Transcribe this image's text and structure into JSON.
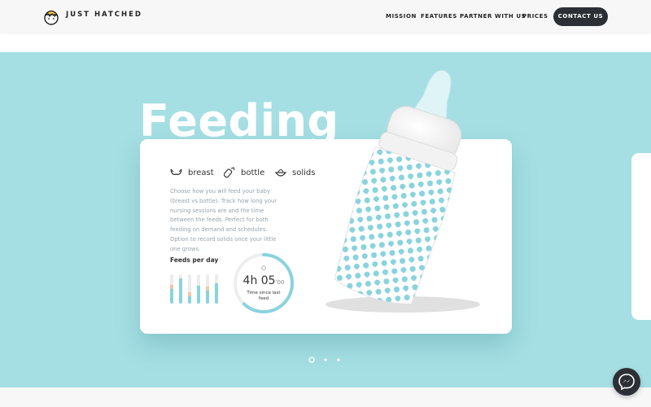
{
  "header": {
    "brand": "JUST HATCHED",
    "nav": [
      {
        "label": "MISSION"
      },
      {
        "label": "FEATURES"
      },
      {
        "label": "PARTNER WITH US"
      },
      {
        "label": "PRICES"
      }
    ],
    "contact_label": "CONTACT US"
  },
  "hero": {
    "headline": "Feeding",
    "options": [
      {
        "label": "breast",
        "icon": "bra-icon"
      },
      {
        "label": "bottle",
        "icon": "bottle-icon"
      },
      {
        "label": "solids",
        "icon": "bowl-icon"
      }
    ],
    "description": "Choose how you will feed your baby (breast vs bottle). Track how long your nursing sessions are and the time between the feeds. Perfect for both feeding on demand and schedules. Option to record solids once your little one grows.",
    "feeds_title": "Feeds per day",
    "feeds_levels": [
      0.55,
      0.85,
      0.3,
      0.6,
      0.5,
      0.7
    ],
    "timer": {
      "hours": "4h",
      "minutes": "05",
      "tick": "'",
      "seconds": "00",
      "caption": "Time since last feed",
      "progress": 0.62
    },
    "carousel": {
      "count": 3,
      "active": 0
    }
  },
  "colors": {
    "hero_bg": "#a5dfe3",
    "accent": "#8ad3de",
    "dark": "#2c2f33"
  }
}
